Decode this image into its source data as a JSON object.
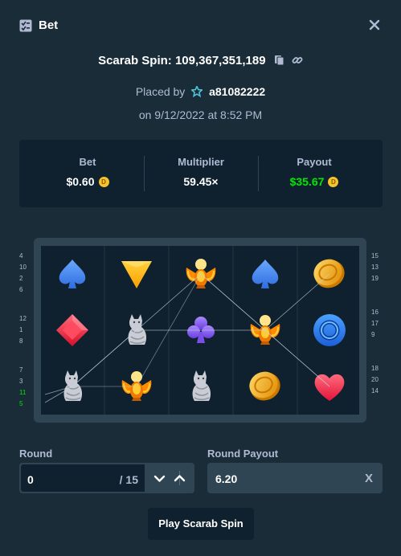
{
  "header": {
    "title": "Bet",
    "icon": "bet-slip-icon",
    "close_icon": "close-icon"
  },
  "game": {
    "title": "Scarab Spin: 109,367,351,189",
    "copy_icon": "copy-icon",
    "link_icon": "link-icon"
  },
  "placed": {
    "prefix": "Placed by",
    "user_icon": "star-badge-icon",
    "username": "a81082222",
    "date": "on 9/12/2022 at 8:52 PM"
  },
  "stats": {
    "bet_label": "Bet",
    "bet_value": "$0.60",
    "multiplier_label": "Multiplier",
    "multiplier_value": "59.45×",
    "payout_label": "Payout",
    "payout_value": "$35.67",
    "currency_icon": "coin-icon"
  },
  "board": {
    "rows": [
      [
        "spade",
        "triangle",
        "scarab",
        "spade",
        "coin"
      ],
      [
        "diamond",
        "cat",
        "club",
        "scarab",
        "ring"
      ],
      [
        "cat",
        "scarab",
        "cat",
        "coin",
        "heart"
      ]
    ]
  },
  "line_numbers": {
    "left": [
      [
        "4",
        "10",
        "2",
        "6"
      ],
      [
        "12",
        "1",
        "8"
      ],
      [
        "7",
        "3",
        "11",
        "5"
      ]
    ],
    "right": [
      [
        "15",
        "13",
        "19"
      ],
      [
        "16",
        "17",
        "9"
      ],
      [
        "18",
        "20",
        "14"
      ]
    ],
    "highlighted": [
      "11",
      "5"
    ]
  },
  "controls": {
    "round_label": "Round",
    "round_value": "0",
    "round_total": "/ 15",
    "round_payout_label": "Round Payout",
    "round_payout_value": "6.20",
    "round_payout_suffix": "X",
    "play_button": "Play Scarab Spin"
  },
  "colors": {
    "background": "#1a2c38",
    "panel": "#0f212e",
    "accent_green": "#00e701",
    "muted": "#b1bad3"
  }
}
